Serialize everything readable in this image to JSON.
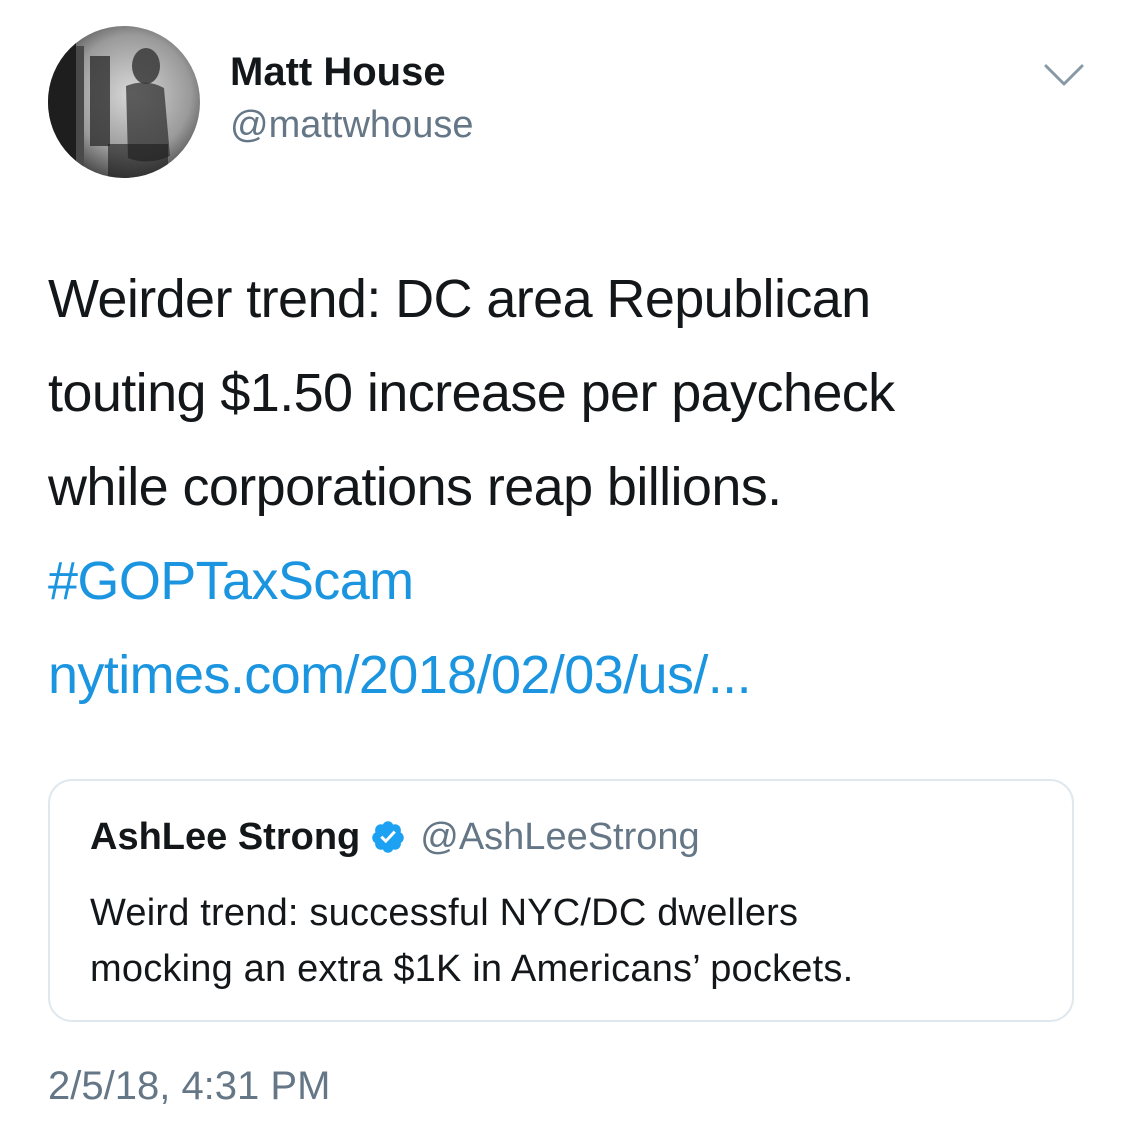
{
  "author": {
    "display_name": "Matt House",
    "handle": "@mattwhouse"
  },
  "tweet": {
    "lines": [
      "Weirder trend: DC area Republican",
      "touting $1.50 increase per paycheck",
      "while corporations reap billions."
    ],
    "hashtag": "#GOPTaxScam",
    "link": "nytimes.com/2018/02/03/us/..."
  },
  "quoted_tweet": {
    "display_name": "AshLee Strong",
    "handle": "@AshLeeStrong",
    "lines": [
      "Weird trend: successful NYC/DC dwellers",
      "mocking an extra $1K in Americans’ pockets."
    ]
  },
  "timestamp": "2/5/18, 4:31 PM",
  "colors": {
    "link": "#1b95e0",
    "secondary_text": "#657786",
    "border": "#e1e8ed",
    "verified": "#1da1f2"
  },
  "icons": {
    "caret": "chevron-down-icon",
    "verified": "verified-badge-icon"
  }
}
